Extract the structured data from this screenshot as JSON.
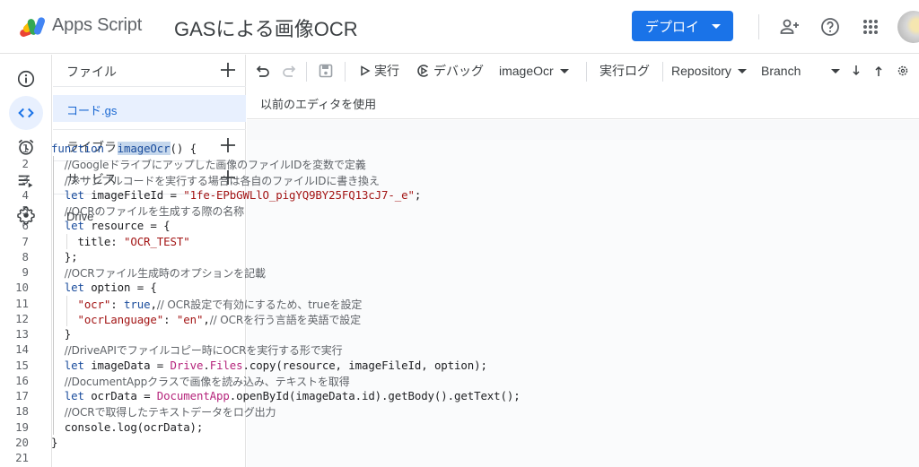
{
  "header": {
    "app_name": "Apps Script",
    "project_title": "GASによる画像OCR",
    "deploy_label": "デプロイ",
    "icons": [
      "add-collaborator-icon",
      "help-icon",
      "apps-grid-icon",
      "avatar"
    ]
  },
  "rail": {
    "items": [
      {
        "name": "overview",
        "icon": "info-icon",
        "active": false
      },
      {
        "name": "editor",
        "icon": "code-icon",
        "active": true
      },
      {
        "name": "triggers",
        "icon": "alarm-clock-icon",
        "active": false
      },
      {
        "name": "executions",
        "icon": "executions-list-icon",
        "active": false
      },
      {
        "name": "settings",
        "icon": "gear-icon",
        "active": false
      }
    ]
  },
  "files_panel": {
    "files_label": "ファイル",
    "file_item": "コード.gs",
    "libraries_label": "ライブラリ",
    "services_label": "サービス",
    "service_item": "Drive"
  },
  "toolbar": {
    "run_label": "実行",
    "debug_label": "デバッグ",
    "function_select": "imageOcr",
    "exec_log_label": "実行ログ",
    "repository_label": "Repository",
    "branch_label": "Branch",
    "legacy_editor_label": "以前のエディタを使用"
  },
  "editor": {
    "line_numbers": [
      "1",
      "2",
      "3",
      "4",
      "5",
      "6",
      "7",
      "8",
      "9",
      "10",
      "11",
      "12",
      "13",
      "14",
      "15",
      "16",
      "17",
      "18",
      "19",
      "20",
      "21"
    ],
    "lines": [
      [
        [
          "kw",
          "function"
        ],
        [
          "",
          "  "
        ],
        [
          "hl",
          "imageOcr"
        ],
        [
          "",
          "() {"
        ]
      ],
      [
        [
          "",
          "  "
        ],
        [
          "cm",
          "//Googleドライブにアップした画像のファイルIDを変数で定義"
        ]
      ],
      [
        [
          "",
          "  "
        ],
        [
          "cm",
          "//※サンプルコードを実行する場合は各自のファイルIDに書き換え"
        ]
      ],
      [
        [
          "",
          "  "
        ],
        [
          "kw",
          "let"
        ],
        [
          "",
          " imageFileId = "
        ],
        [
          "str",
          "\"1fe-EPbGWLlO_pigYQ9BY25FQ13cJ7-_e\""
        ],
        [
          "",
          ";"
        ]
      ],
      [
        [
          "",
          "  "
        ],
        [
          "cm",
          "//OCRのファイルを生成する際の名称"
        ]
      ],
      [
        [
          "",
          "  "
        ],
        [
          "kw",
          "let"
        ],
        [
          "",
          " resource = {"
        ]
      ],
      [
        [
          "",
          "    title: "
        ],
        [
          "str",
          "\"OCR_TEST\""
        ]
      ],
      [
        [
          "",
          "  };"
        ]
      ],
      [
        [
          "",
          "  "
        ],
        [
          "cm",
          "//OCRファイル生成時のオプションを記載"
        ]
      ],
      [
        [
          "",
          "  "
        ],
        [
          "kw",
          "let"
        ],
        [
          "",
          " option = {"
        ]
      ],
      [
        [
          "",
          "    "
        ],
        [
          "str",
          "\"ocr\""
        ],
        [
          "",
          ": "
        ],
        [
          "kw",
          "true"
        ],
        [
          "",
          ","
        ],
        [
          "cm",
          "// OCR設定で有効にするため、trueを設定"
        ]
      ],
      [
        [
          "",
          "    "
        ],
        [
          "str",
          "\"ocrLanguage\""
        ],
        [
          "",
          ": "
        ],
        [
          "str",
          "\"en\""
        ],
        [
          "",
          ","
        ],
        [
          "cm",
          "// OCRを行う言語を英語で設定"
        ]
      ],
      [
        [
          "",
          "  }"
        ]
      ],
      [
        [
          "",
          "  "
        ],
        [
          "cm",
          "//DriveAPIでファイルコピー時にOCRを実行する形で実行"
        ]
      ],
      [
        [
          "",
          "  "
        ],
        [
          "kw",
          "let"
        ],
        [
          "",
          " imageData = "
        ],
        [
          "obj",
          "Drive"
        ],
        [
          "",
          "."
        ],
        [
          "obj",
          "Files"
        ],
        [
          "",
          ".copy(resource, imageFileId, option);"
        ]
      ],
      [
        [
          "",
          "  "
        ],
        [
          "cm",
          "//DocumentAppクラスで画像を読み込み、テキストを取得"
        ]
      ],
      [
        [
          "",
          "  "
        ],
        [
          "kw",
          "let"
        ],
        [
          "",
          " ocrData = "
        ],
        [
          "obj",
          "DocumentApp"
        ],
        [
          "",
          ".openById(imageData.id).getBody().getText();"
        ]
      ],
      [
        [
          "",
          "  "
        ],
        [
          "cm",
          "//OCRで取得したテキストデータをログ出力"
        ]
      ],
      [
        [
          "",
          "  console.log(ocrData);"
        ]
      ],
      [
        [
          "",
          "}"
        ]
      ],
      [
        [
          "",
          ""
        ]
      ]
    ]
  }
}
